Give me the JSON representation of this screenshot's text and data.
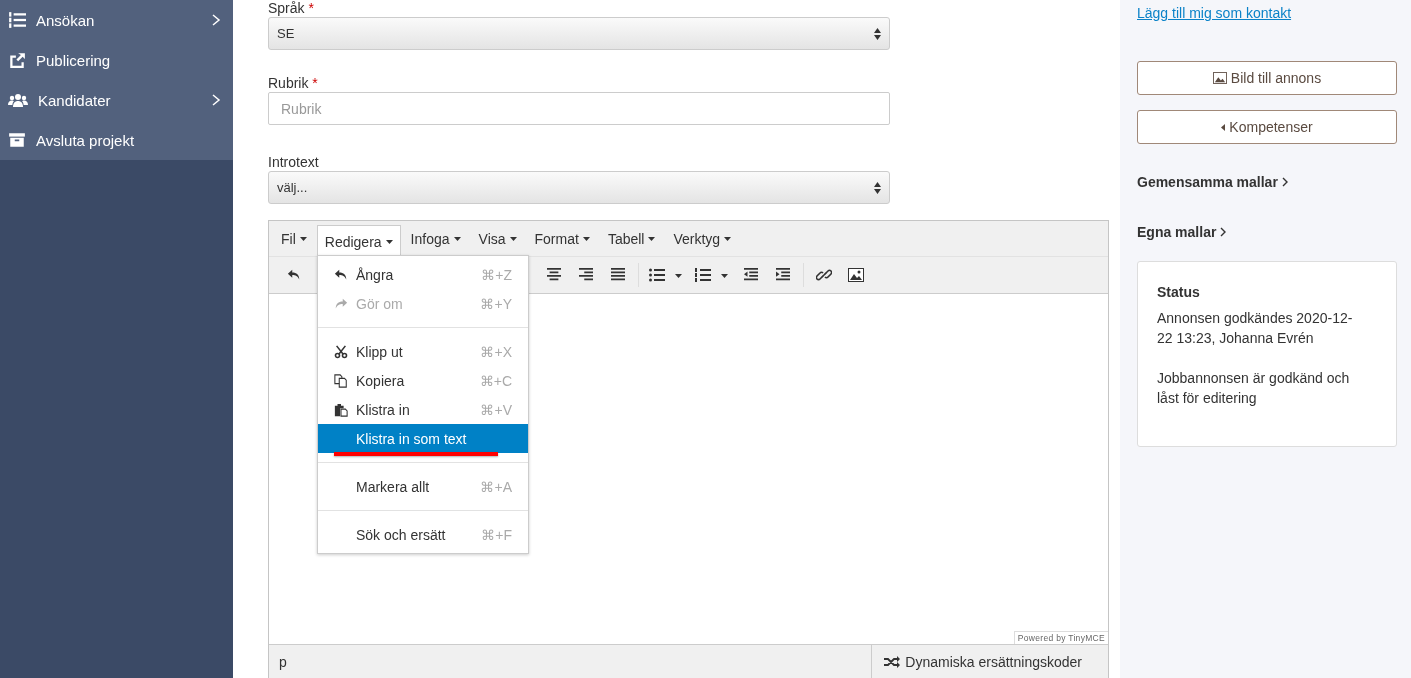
{
  "sidebar": {
    "items": [
      {
        "label": "Ansökan",
        "has_submenu": true
      },
      {
        "label": "Publicering",
        "has_submenu": false
      },
      {
        "label": "Kandidater",
        "has_submenu": true
      },
      {
        "label": "Avsluta projekt",
        "has_submenu": false
      }
    ]
  },
  "form": {
    "fields": [
      {
        "kind": "select",
        "label": "Språk",
        "required_mark": "*",
        "value": "SE"
      },
      {
        "kind": "input",
        "label": "Rubrik",
        "required_mark": "*",
        "placeholder": "Rubrik"
      },
      {
        "kind": "select",
        "label": "Introtext",
        "value": "välj..."
      }
    ]
  },
  "editor": {
    "menubar": [
      {
        "label": "Fil",
        "selected": false
      },
      {
        "label": "Redigera",
        "selected": true
      },
      {
        "label": "Infoga",
        "selected": false
      },
      {
        "label": "Visa",
        "selected": false
      },
      {
        "label": "Format",
        "selected": false
      },
      {
        "label": "Tabell",
        "selected": false
      },
      {
        "label": "Verktyg",
        "selected": false
      }
    ],
    "menu": [
      {
        "kind": "item",
        "label": "Ångra",
        "shortcut": "⌘+Z",
        "disabled": false,
        "selected": false
      },
      {
        "kind": "item",
        "label": "Gör om",
        "shortcut": "⌘+Y",
        "disabled": true,
        "selected": false
      },
      {
        "kind": "separator"
      },
      {
        "kind": "item",
        "label": "Klipp ut",
        "shortcut": "⌘+X",
        "disabled": false,
        "selected": false
      },
      {
        "kind": "item",
        "label": "Kopiera",
        "shortcut": "⌘+C",
        "disabled": false,
        "selected": false
      },
      {
        "kind": "item",
        "label": "Klistra in",
        "shortcut": "⌘+V",
        "disabled": false,
        "selected": false
      },
      {
        "kind": "item",
        "label": "Klistra in som text",
        "disabled": false,
        "selected": true
      },
      {
        "kind": "separator"
      },
      {
        "kind": "item",
        "label": "Markera allt",
        "shortcut": "⌘+A",
        "disabled": false,
        "selected": false
      },
      {
        "kind": "separator"
      },
      {
        "kind": "item",
        "label": "Sök och ersätt",
        "shortcut": "⌘+F",
        "disabled": false,
        "selected": false
      }
    ],
    "branding": "Powered by TinyMCE",
    "path": "p",
    "codes_button": "Dynamiska ersättningskoder"
  },
  "right": {
    "contact_link": "Lägg till mig som kontakt",
    "buttons": [
      {
        "label": "Bild till annons"
      },
      {
        "label": "Kompetenser"
      }
    ],
    "template_links": [
      "Gemensamma mallar",
      "Egna mallar"
    ],
    "status": {
      "title": "Status",
      "lines": [
        "Annonsen godkändes 2020-12-22 13:23, Johanna Evrén",
        "Jobbannonsen är godkänd och låst för editering"
      ]
    }
  }
}
